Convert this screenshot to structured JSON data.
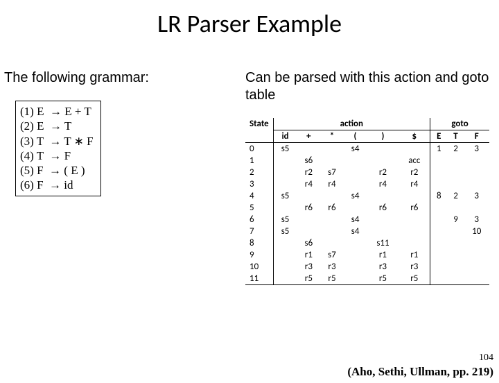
{
  "title": "LR Parser Example",
  "left_heading": "The following grammar:",
  "right_heading": "Can be parsed with this action and goto table",
  "grammar": [
    "(1) E  → E + T",
    "(2) E  → T",
    "(3) T  → T ∗ F",
    "(4) T  → F",
    "(5) F  → ( E )",
    "(6) F  → id"
  ],
  "table": {
    "state_label": "State",
    "action_label": "action",
    "goto_label": "goto",
    "action_cols": [
      "id",
      "+",
      "*",
      "(",
      ")",
      "$"
    ],
    "goto_cols": [
      "E",
      "T",
      "F"
    ],
    "rows": [
      {
        "state": "0",
        "action": [
          "s5",
          "",
          "",
          "s4",
          "",
          ""
        ],
        "goto": [
          "1",
          "2",
          "3"
        ]
      },
      {
        "state": "1",
        "action": [
          "",
          "s6",
          "",
          "",
          "",
          "acc"
        ],
        "goto": [
          "",
          "",
          ""
        ]
      },
      {
        "state": "2",
        "action": [
          "",
          "r2",
          "s7",
          "",
          "r2",
          "r2"
        ],
        "goto": [
          "",
          "",
          ""
        ]
      },
      {
        "state": "3",
        "action": [
          "",
          "r4",
          "r4",
          "",
          "r4",
          "r4"
        ],
        "goto": [
          "",
          "",
          ""
        ]
      },
      {
        "state": "4",
        "action": [
          "s5",
          "",
          "",
          "s4",
          "",
          ""
        ],
        "goto": [
          "8",
          "2",
          "3"
        ]
      },
      {
        "state": "5",
        "action": [
          "",
          "r6",
          "r6",
          "",
          "r6",
          "r6"
        ],
        "goto": [
          "",
          "",
          ""
        ]
      },
      {
        "state": "6",
        "action": [
          "s5",
          "",
          "",
          "s4",
          "",
          ""
        ],
        "goto": [
          "",
          "9",
          "3"
        ]
      },
      {
        "state": "7",
        "action": [
          "s5",
          "",
          "",
          "s4",
          "",
          ""
        ],
        "goto": [
          "",
          "",
          "10"
        ]
      },
      {
        "state": "8",
        "action": [
          "",
          "s6",
          "",
          "",
          "s11",
          ""
        ],
        "goto": [
          "",
          "",
          ""
        ]
      },
      {
        "state": "9",
        "action": [
          "",
          "r1",
          "s7",
          "",
          "r1",
          "r1"
        ],
        "goto": [
          "",
          "",
          ""
        ]
      },
      {
        "state": "10",
        "action": [
          "",
          "r3",
          "r3",
          "",
          "r3",
          "r3"
        ],
        "goto": [
          "",
          "",
          ""
        ]
      },
      {
        "state": "11",
        "action": [
          "",
          "r5",
          "r5",
          "",
          "r5",
          "r5"
        ],
        "goto": [
          "",
          "",
          ""
        ]
      }
    ]
  },
  "page_number": "104",
  "citation": "(Aho, Sethi, Ullman, pp. 219)"
}
